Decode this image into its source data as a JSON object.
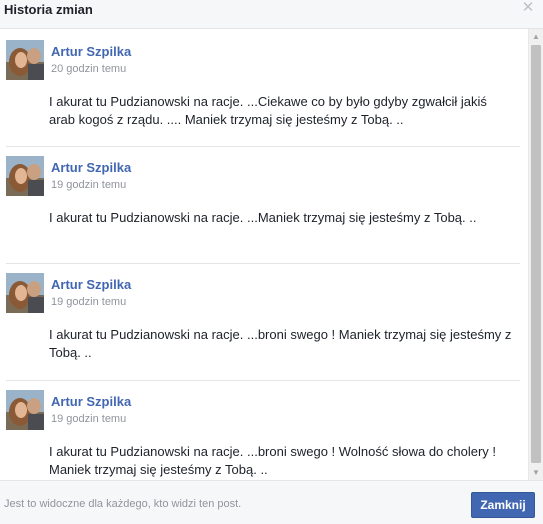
{
  "dialog": {
    "title": "Historia zmian",
    "close_icon": "close-icon"
  },
  "entries": [
    {
      "author": "Artur Szpilka",
      "time": "20 godzin temu",
      "text": "I akurat tu Pudzianowski na racje. ...Ciekawe co by było gdyby zgwałcił jakiś arab kogoś z rządu. .... Maniek trzymaj się jesteśmy z Tobą. .."
    },
    {
      "author": "Artur Szpilka",
      "time": "19 godzin temu",
      "text": "I akurat tu Pudzianowski na racje. ...Maniek trzymaj się jesteśmy z Tobą. .."
    },
    {
      "author": "Artur Szpilka",
      "time": "19 godzin temu",
      "text": "I akurat tu Pudzianowski na racje. ...broni swego ! Maniek trzymaj się jesteśmy z Tobą. .."
    },
    {
      "author": "Artur Szpilka",
      "time": "19 godzin temu",
      "text": "I akurat tu Pudzianowski na racje. ...broni swego ! Wolność słowa do cholery ! Maniek trzymaj się jesteśmy z Tobą. .."
    }
  ],
  "footer": {
    "note": "Jest to widoczne dla każdego, kto widzi ten post.",
    "close_button": "Zamknij"
  },
  "colors": {
    "accent": "#4267b2",
    "author": "#4267b2",
    "muted": "#90949c"
  }
}
